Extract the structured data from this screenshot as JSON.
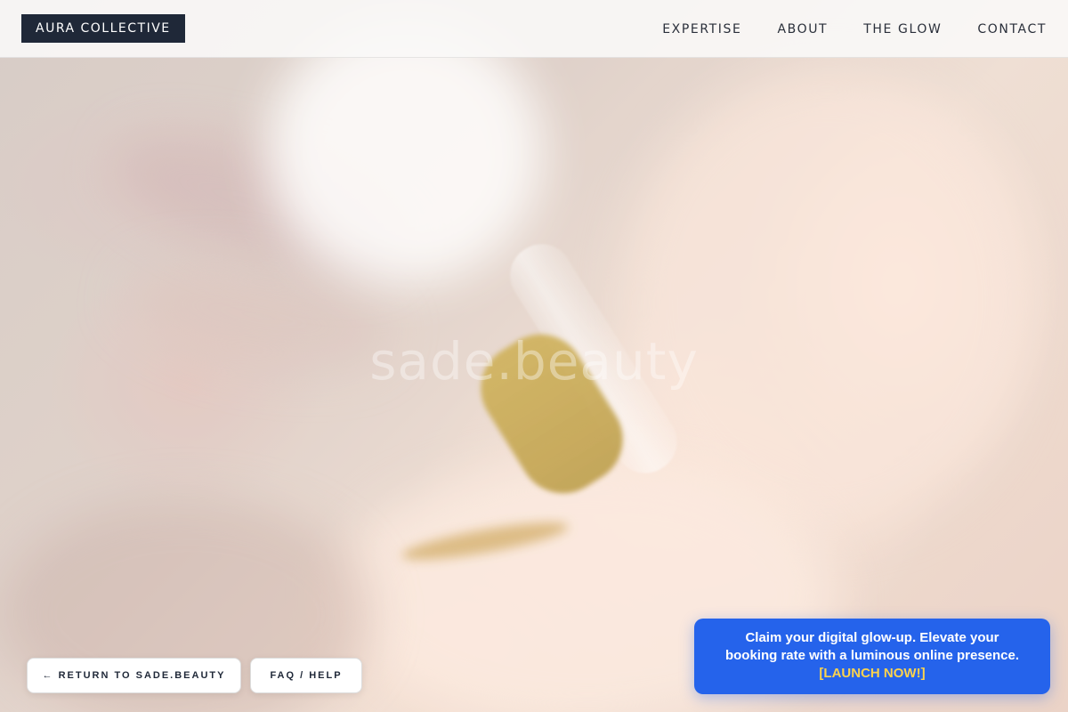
{
  "header": {
    "brand": "AURA COLLECTIVE",
    "nav": [
      {
        "label": "EXPERTISE"
      },
      {
        "label": "ABOUT"
      },
      {
        "label": "THE GLOW"
      },
      {
        "label": "CONTACT"
      }
    ]
  },
  "hero": {
    "watermark": "sade.beauty",
    "image": "dropper-oil-on-skin-photo"
  },
  "footer_buttons": {
    "return_label": "← RETURN TO SADE.BEAUTY",
    "faq_label": "FAQ / HELP"
  },
  "promo": {
    "text": "Claim your digital glow-up. Elevate your booking rate with a luminous online presence.",
    "cta": "[LAUNCH NOW!]"
  },
  "colors": {
    "brand_bg": "#1f2838",
    "promo_bg": "#2563eb",
    "promo_cta": "#fcd34d"
  }
}
